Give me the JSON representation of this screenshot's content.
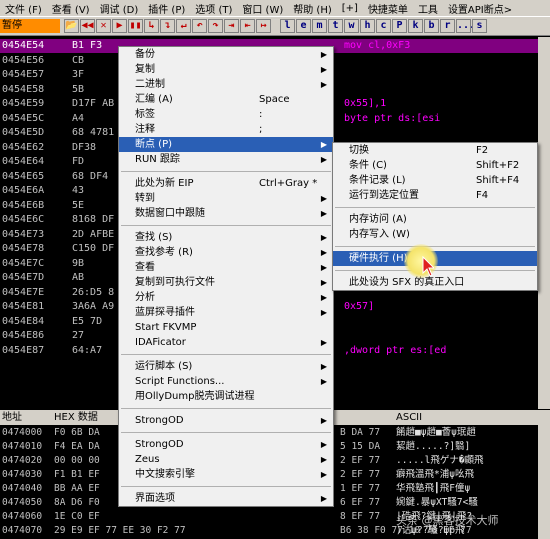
{
  "menubar": [
    "文件 (F)",
    "查看 (V)",
    "调试 (D)",
    "插件 (P)",
    "选项 (T)",
    "窗口 (W)",
    "帮助 (H)",
    "[+]",
    "快捷菜单",
    "工具",
    "设置API断点>"
  ],
  "toolbar": {
    "status": "暂停",
    "icons": [
      "📂",
      "◀◀",
      "✕",
      "▶",
      "▮▮",
      "↳",
      "↴",
      "↵",
      "↶",
      "↷",
      "⇥",
      "⇤",
      "↦"
    ],
    "letters": [
      "l",
      "e",
      "m",
      "t",
      "w",
      "h",
      "c",
      "P",
      "k",
      "b",
      "r",
      "...",
      "s"
    ]
  },
  "cpu_rows": [
    {
      "addr": "0454E54",
      "hex": "B1 F3",
      "asm": "mov cl,0xF3"
    },
    {
      "addr": "0454E56",
      "hex": "CB",
      "asm": ""
    },
    {
      "addr": "0454E57",
      "hex": "3F",
      "asm": ""
    },
    {
      "addr": "0454E58",
      "hex": "5B",
      "asm": ""
    },
    {
      "addr": "0454E59",
      "hex": "D17F AB",
      "asm": "0x55],1"
    },
    {
      "addr": "0454E5C",
      "hex": "A4",
      "asm": "byte ptr ds:[esi"
    },
    {
      "addr": "0454E5D",
      "hex": "68 4781",
      "asm": ""
    },
    {
      "addr": "0454E62",
      "hex": "DF38",
      "asm": ""
    },
    {
      "addr": "0454E64",
      "hex": "FD",
      "asm": ""
    },
    {
      "addr": "0454E65",
      "hex": "68 DF4",
      "asm": ""
    },
    {
      "addr": "0454E6A",
      "hex": "43",
      "asm": ""
    },
    {
      "addr": "0454E6B",
      "hex": "5E",
      "asm": ""
    },
    {
      "addr": "0454E6C",
      "hex": "8168 DF",
      "asm": ""
    },
    {
      "addr": "0454E73",
      "hex": "2D AFBE",
      "asm": ""
    },
    {
      "addr": "0454E78",
      "hex": "C150 DF",
      "asm": ""
    },
    {
      "addr": "0454E7C",
      "hex": "9B",
      "asm": ""
    },
    {
      "addr": "0454E7D",
      "hex": "AB",
      "asm": ""
    },
    {
      "addr": "0454E7E",
      "hex": "26:D5 8",
      "asm": ""
    },
    {
      "addr": "0454E81",
      "hex": "3A6A A9",
      "asm": "0x57]"
    },
    {
      "addr": "0454E84",
      "hex": "E5 7D",
      "asm": ""
    },
    {
      "addr": "0454E86",
      "hex": "27",
      "asm": ""
    },
    {
      "addr": "0454E87",
      "hex": "64:A7",
      "asm": ",dword ptr es:[ed"
    }
  ],
  "dump": {
    "headers": {
      "addr": "地址",
      "hex": "HEX 数据",
      "ascii": "ASCII"
    },
    "rows": [
      {
        "a": "0474000",
        "h": "F0 6B DA",
        "h2": "B DA 77",
        "s": "餚趙■ψ趙■薈ψ珉趙"
      },
      {
        "a": "0474010",
        "h": "F4 EA DA",
        "h2": "5 15 DA",
        "s": "絜趙.....?]翳]"
      },
      {
        "a": "0474020",
        "h": "00 00 00",
        "h2": "2 EF 77",
        "s": ".....l飛ゲナ�顣飛"
      },
      {
        "a": "0474030",
        "h": "F1 B1 EF",
        "h2": "2 EF 77",
        "s": "癖飛溫飛*浦ψ吆飛"
      },
      {
        "a": "0474040",
        "h": "BB AA EF",
        "h2": "1 EF 77",
        "s": "华飛塾飛┃飛F僮ψ"
      },
      {
        "a": "0474050",
        "h": "8A D6 F0",
        "h2": "6 EF 77",
        "s": "婉鍵.暴ψXT騷7<騷"
      },
      {
        "a": "0474060",
        "h": "1E C0 EF",
        "h2": "8 EF 77",
        "s": "|硞飛?鍵|飛|飛?"
      },
      {
        "a": "0474070",
        "h": "29 E9 EF 77 EE 30 F2 77",
        "h2": "B6 38 F0 77 10 70 EF 77",
        "s": ")诂ψ??騷?ψp飛"
      }
    ]
  },
  "context_menu": [
    {
      "label": "备份",
      "shortcut": "",
      "arrow": true
    },
    {
      "label": "复制",
      "shortcut": "",
      "arrow": true
    },
    {
      "label": "二进制",
      "shortcut": "",
      "arrow": true
    },
    {
      "label": "汇编 (A)",
      "shortcut": "Space",
      "arrow": false
    },
    {
      "label": "标签",
      "shortcut": ":",
      "arrow": false
    },
    {
      "label": "注释",
      "shortcut": ";",
      "arrow": false
    },
    {
      "label": "断点 (P)",
      "shortcut": "",
      "arrow": true,
      "highlight": true
    },
    {
      "label": "RUN 跟踪",
      "shortcut": "",
      "arrow": true
    },
    {
      "sep": true
    },
    {
      "label": "此处为新 EIP",
      "shortcut": "Ctrl+Gray *",
      "arrow": false
    },
    {
      "label": "转到",
      "shortcut": "",
      "arrow": true
    },
    {
      "label": "数据窗口中跟随",
      "shortcut": "",
      "arrow": true
    },
    {
      "sep": true
    },
    {
      "label": "查找 (S)",
      "shortcut": "",
      "arrow": true
    },
    {
      "label": "查找参考 (R)",
      "shortcut": "",
      "arrow": true
    },
    {
      "label": "查看",
      "shortcut": "",
      "arrow": true
    },
    {
      "label": "复制到可执行文件",
      "shortcut": "",
      "arrow": true
    },
    {
      "label": "分析",
      "shortcut": "",
      "arrow": true
    },
    {
      "label": "蓝屏探寻插件",
      "shortcut": "",
      "arrow": true
    },
    {
      "label": "Start FKVMP",
      "shortcut": "",
      "arrow": false
    },
    {
      "label": "IDAFicator",
      "shortcut": "",
      "arrow": true
    },
    {
      "sep": true
    },
    {
      "label": "运行脚本 (S)",
      "shortcut": "",
      "arrow": true
    },
    {
      "label": "Script Functions...",
      "shortcut": "",
      "arrow": true
    },
    {
      "label": "用OllyDump脱壳调试进程",
      "shortcut": "",
      "arrow": false
    },
    {
      "sep": true
    },
    {
      "label": "StrongOD",
      "shortcut": "",
      "arrow": true
    },
    {
      "sep": true
    },
    {
      "label": "StrongOD",
      "shortcut": "",
      "arrow": true
    },
    {
      "label": "Zeus",
      "shortcut": "",
      "arrow": true
    },
    {
      "label": "中文搜索引擎",
      "shortcut": "",
      "arrow": true
    },
    {
      "sep": true
    },
    {
      "label": "界面选项",
      "shortcut": "",
      "arrow": true
    }
  ],
  "breakpoint_submenu": [
    {
      "label": "切换",
      "shortcut": "F2"
    },
    {
      "label": "条件 (C)",
      "shortcut": "Shift+F2"
    },
    {
      "label": "条件记录 (L)",
      "shortcut": "Shift+F4"
    },
    {
      "label": "运行到选定位置",
      "shortcut": "F4"
    },
    {
      "sep": true
    },
    {
      "label": "内存访问 (A)",
      "shortcut": ""
    },
    {
      "label": "内存写入 (W)",
      "shortcut": ""
    },
    {
      "sep": true
    },
    {
      "label": "硬件执行 (H)",
      "shortcut": "",
      "highlight": true
    },
    {
      "sep": true
    },
    {
      "label": "此处设为 SFX 的真正入口",
      "shortcut": ""
    }
  ],
  "watermark": "头条 @黑客技术大师"
}
